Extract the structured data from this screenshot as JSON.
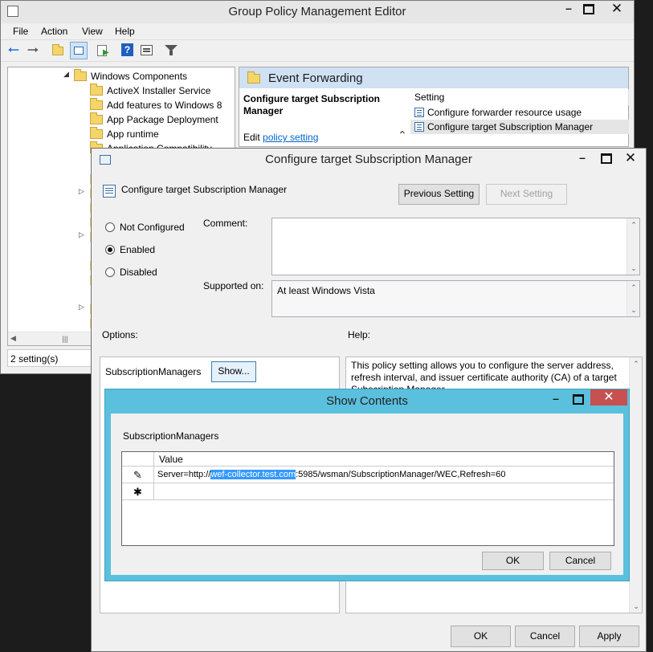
{
  "gpme": {
    "title": "Group Policy Management Editor",
    "menu": [
      "File",
      "Action",
      "View",
      "Help"
    ],
    "tree": [
      "Windows Components",
      "ActiveX Installer Service",
      "Add features to Windows 8",
      "App Package Deployment",
      "App runtime",
      "Application Compatibility"
    ],
    "status": "2 setting(s)",
    "pane_title": "Event Forwarding",
    "policy_name": "Configure target Subscription Manager",
    "edit_prefix": "Edit",
    "edit_link": "policy setting",
    "setting_header": "Setting",
    "settings": [
      "Configure forwarder resource usage",
      "Configure target Subscription Manager"
    ]
  },
  "policy_dialog": {
    "title": "Configure target Subscription Manager",
    "heading": "Configure target Subscription Manager",
    "prev_label": "Previous Setting",
    "next_label": "Next Setting",
    "radio_not_configured": "Not Configured",
    "radio_enabled": "Enabled",
    "radio_disabled": "Disabled",
    "comment_label": "Comment:",
    "supported_label": "Supported on:",
    "supported_value": "At least Windows Vista",
    "options_label": "Options:",
    "help_label": "Help:",
    "option_name": "SubscriptionManagers",
    "show_label": "Show...",
    "help_text": "This policy setting allows you to configure the server address, refresh interval, and issuer certificate authority (CA) of a target Subscription Manager.",
    "ok": "OK",
    "cancel": "Cancel",
    "apply": "Apply"
  },
  "show_contents": {
    "title": "Show Contents",
    "label": "SubscriptionManagers",
    "column": "Value",
    "row_prefix": "Server=http://",
    "row_selected": "wef-collector.test.com",
    "row_suffix": ":5985/wsman/SubscriptionManager/WEC,Refresh=60",
    "ok": "OK",
    "cancel": "Cancel"
  },
  "colors": {
    "accent": "#5bc0de",
    "selection": "#3399ff",
    "close_red": "#c75050",
    "link": "#0066cc"
  }
}
